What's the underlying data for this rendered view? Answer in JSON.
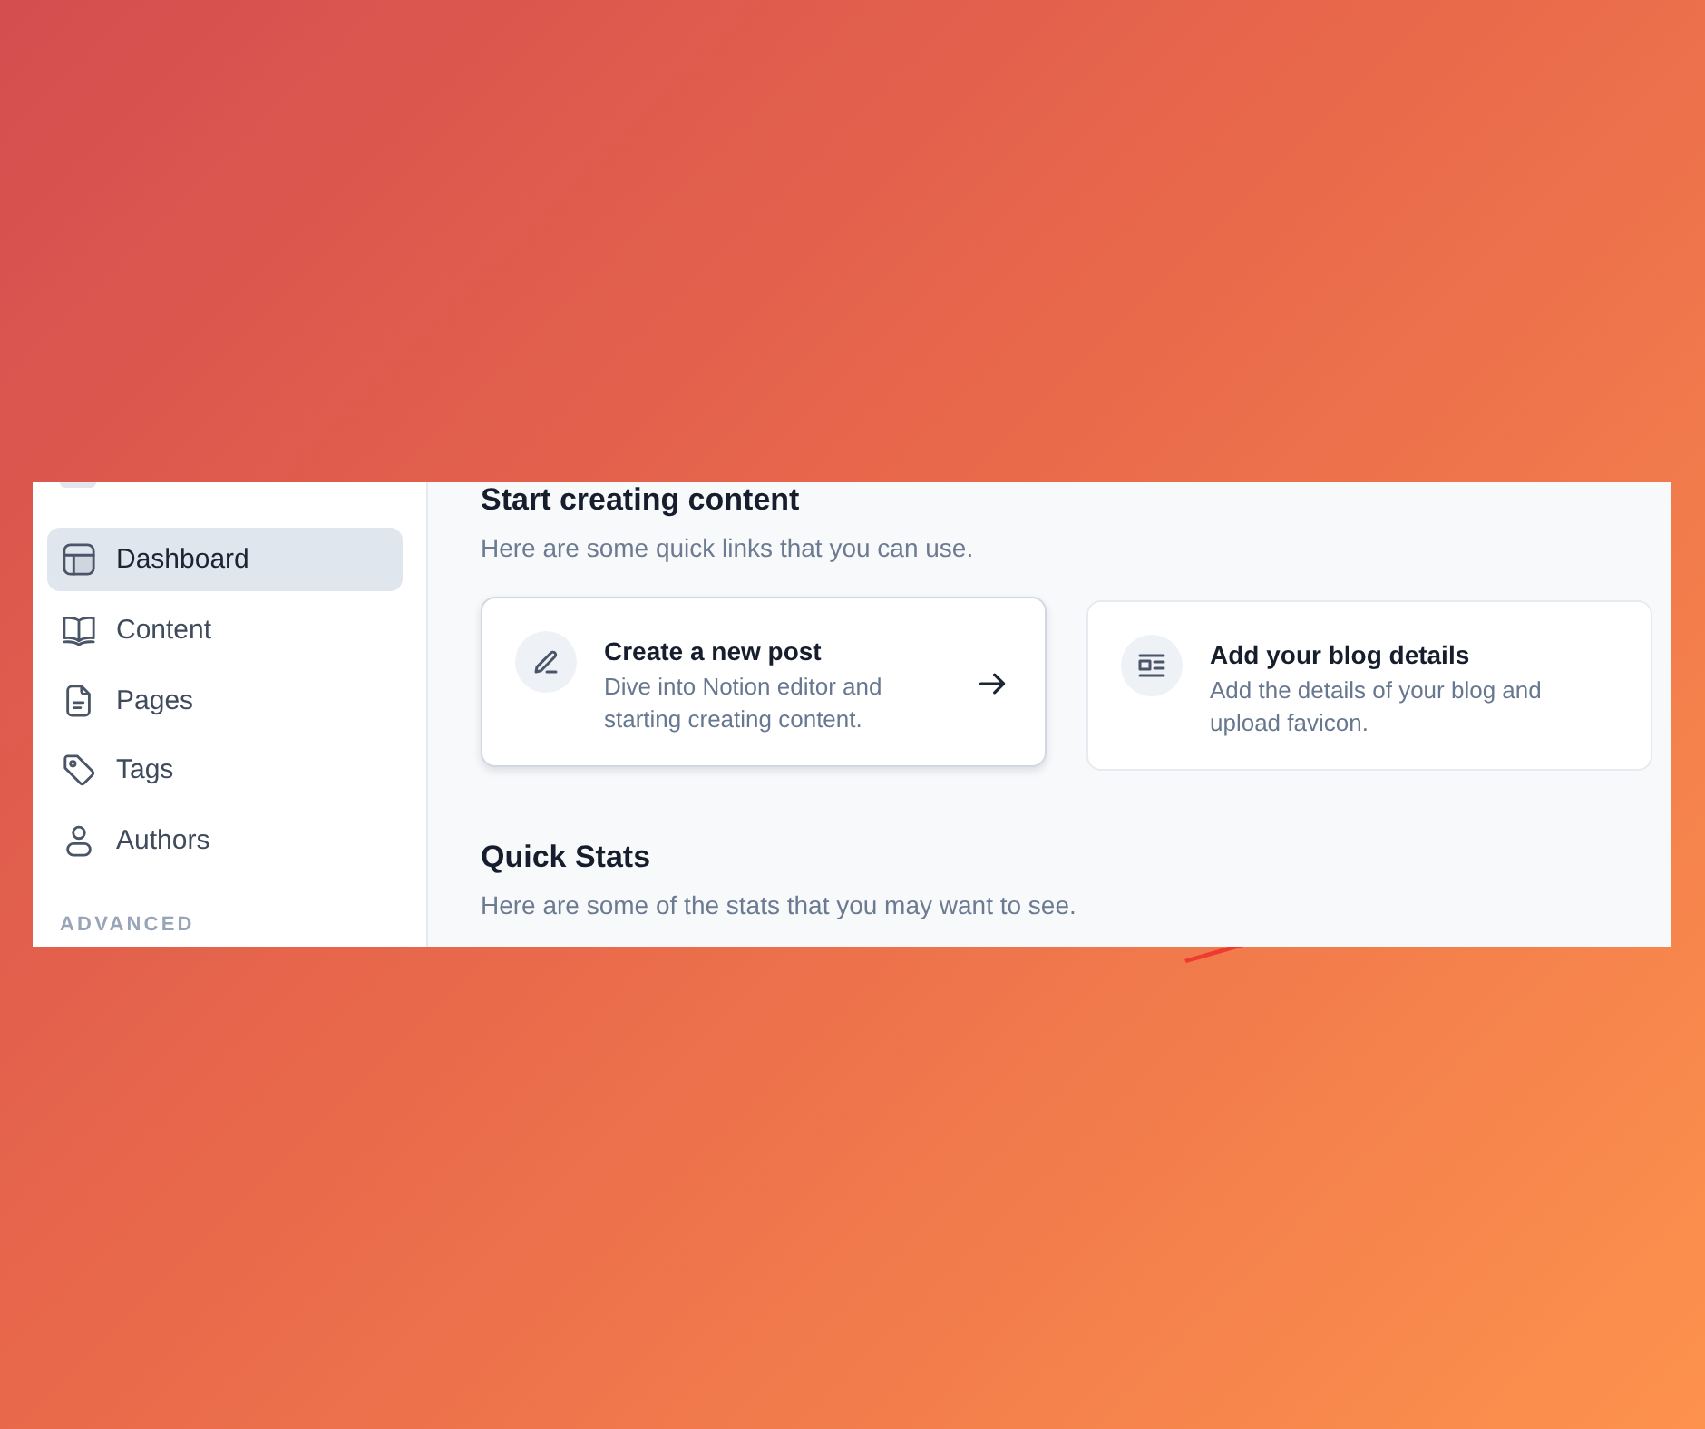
{
  "sidebar": {
    "items": [
      {
        "kind": "dashboard",
        "label": "Dashboard",
        "selected": true
      },
      {
        "kind": "content",
        "label": "Content",
        "selected": false
      },
      {
        "kind": "pages",
        "label": "Pages",
        "selected": false
      },
      {
        "kind": "tags",
        "label": "Tags",
        "selected": false
      },
      {
        "kind": "authors",
        "label": "Authors",
        "selected": false
      }
    ],
    "group_label": "ADVANCED"
  },
  "sections": [
    {
      "title": "Start creating content",
      "subtitle": "Here are some quick links that you can use.",
      "cards": [
        {
          "kind": "new_post",
          "title": "Create a new post",
          "description": "Dive into Notion editor and starting creating content.",
          "highlighted": true
        },
        {
          "kind": "blog_details",
          "title": "Add your blog details",
          "description": "Add the details of your blog and upload favicon.",
          "highlighted": false
        }
      ]
    },
    {
      "title": "Quick Stats",
      "subtitle": "Here are some of the stats that you may want to see."
    }
  ]
}
